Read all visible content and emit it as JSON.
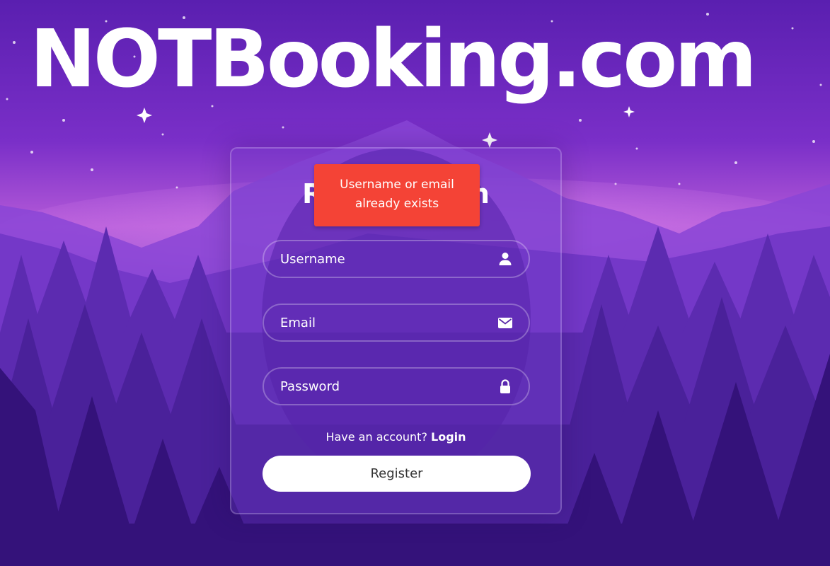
{
  "brand": {
    "title": "NOTBooking.com"
  },
  "form": {
    "title": "Registration",
    "error_toast": "Username or email already exists",
    "fields": [
      {
        "placeholder": "Username",
        "icon": "user-icon"
      },
      {
        "placeholder": "Email",
        "icon": "envelope-icon"
      },
      {
        "placeholder": "Password",
        "icon": "lock-icon"
      }
    ],
    "have_account_text": "Have an account?",
    "login_link": "Login",
    "register_button": "Register"
  },
  "colors": {
    "toast_background": "#f44336",
    "button_background": "#ffffff",
    "button_text": "#333333"
  }
}
